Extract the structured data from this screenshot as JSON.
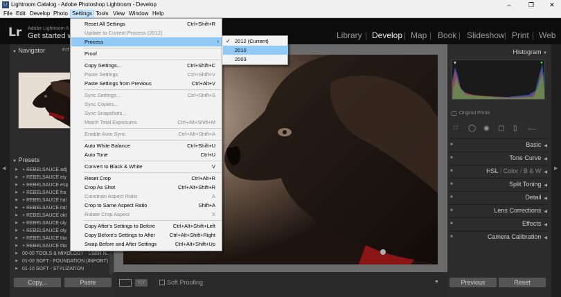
{
  "window": {
    "title": "Lightroom Catalog - Adobe Photoshop Lightroom - Develop",
    "app_icon": "Lr",
    "controls": [
      "–",
      "❐",
      "✕"
    ]
  },
  "menubar": [
    "File",
    "Edit",
    "Develop",
    "Photo",
    "Settings",
    "Tools",
    "View",
    "Window",
    "Help"
  ],
  "identity": {
    "logo": "Lr",
    "version": "Adobe Lightroom 6",
    "headline": "Get started w"
  },
  "modules": [
    "Library",
    "Develop",
    "Map",
    "Book",
    "Slideshow",
    "Print",
    "Web"
  ],
  "active_module": "Develop",
  "left_panel": {
    "navigator_label": "Navigator",
    "navigator_fit": "FIT",
    "presets_label": "Presets",
    "presets": [
      "+ REBELSAUCE adj",
      "+ REBELSAUCE eiy",
      "+ REBELSAUCE esp",
      "+ REBELSAUCE fra",
      "+ REBELSAUCE ital",
      "+ REBELSAUCE ital",
      "+ REBELSAUCE okt",
      "+ REBELSAUCE oly",
      "+ REBELSAUCE oly",
      "+ REBELSAUCE tita",
      "+ REBELSAUCE tita",
      "00-00 TOOLS & MIXOLOGY - USER N...",
      "01-00 SOFT - FOUNDATION (IMPORT)",
      "01-10 SOFT - STYLIZATION"
    ],
    "copy_label": "Copy...",
    "paste_label": "Paste"
  },
  "toolbar": {
    "yy_label": "Y|Y",
    "soft_proofing_label": "Soft Proofing"
  },
  "right_panel": {
    "histogram_label": "Histogram",
    "original_photo_label": "Original Photo",
    "sections": [
      "Basic",
      "Tone Curve",
      "HSL / Color / B & W",
      "Split Toning",
      "Detail",
      "Lens Corrections",
      "Effects",
      "Camera Calibration"
    ],
    "hsl_parts": [
      "HSL",
      "/",
      "Color",
      "/",
      "B & W"
    ],
    "previous_label": "Previous",
    "reset_label": "Reset"
  },
  "settings_menu": {
    "items": [
      {
        "label": "Reset All Settings",
        "shortcut": "Ctrl+Shift+R",
        "disabled": false
      },
      {
        "label": "Update to Current Process (2012)",
        "shortcut": "",
        "disabled": true
      },
      {
        "label": "Process",
        "shortcut": "",
        "disabled": false,
        "submenu": true,
        "highlighted": true
      },
      {
        "label": "Proof",
        "shortcut": "",
        "disabled": false
      },
      {
        "label": "Copy Settings...",
        "shortcut": "Ctrl+Shift+C",
        "disabled": false
      },
      {
        "label": "Paste Settings",
        "shortcut": "Ctrl+Shift+V",
        "disabled": true
      },
      {
        "label": "Paste Settings from Previous",
        "shortcut": "Ctrl+Alt+V",
        "disabled": false
      },
      {
        "label": "Sync Settings...",
        "shortcut": "Ctrl+Shift+S",
        "disabled": true
      },
      {
        "label": "Sync Copies...",
        "shortcut": "",
        "disabled": true
      },
      {
        "label": "Sync Snapshots...",
        "shortcut": "",
        "disabled": true
      },
      {
        "label": "Match Total Exposures",
        "shortcut": "Ctrl+Alt+Shift+M",
        "disabled": true
      },
      {
        "label": "Enable Auto Sync",
        "shortcut": "Ctrl+Alt+Shift+A",
        "disabled": true
      },
      {
        "label": "Auto White Balance",
        "shortcut": "Ctrl+Shift+U",
        "disabled": false
      },
      {
        "label": "Auto Tone",
        "shortcut": "Ctrl+U",
        "disabled": false
      },
      {
        "label": "Convert to Black & White",
        "shortcut": "V",
        "disabled": false
      },
      {
        "label": "Reset Crop",
        "shortcut": "Ctrl+Alt+R",
        "disabled": false
      },
      {
        "label": "Crop As Shot",
        "shortcut": "Ctrl+Alt+Shift+R",
        "disabled": false
      },
      {
        "label": "Constrain Aspect Ratio",
        "shortcut": "A",
        "disabled": true
      },
      {
        "label": "Crop to Same Aspect Ratio",
        "shortcut": "Shift+A",
        "disabled": false
      },
      {
        "label": "Rotate Crop Aspect",
        "shortcut": "X",
        "disabled": true
      },
      {
        "label": "Copy After's Settings to Before",
        "shortcut": "Ctrl+Alt+Shift+Left",
        "disabled": false
      },
      {
        "label": "Copy Before's Settings to After",
        "shortcut": "Ctrl+Alt+Shift+Right",
        "disabled": false
      },
      {
        "label": "Swap Before and After Settings",
        "shortcut": "Ctrl+Alt+Shift+Up",
        "disabled": false
      }
    ]
  },
  "process_submenu": {
    "items": [
      {
        "label": "2012 (Current)",
        "checked": true,
        "highlighted": false
      },
      {
        "label": "2010",
        "checked": false,
        "highlighted": true
      },
      {
        "label": "2003",
        "checked": false,
        "highlighted": false
      }
    ]
  },
  "colors": {
    "menu_highlight": "#91c9f7",
    "panel_bg": "#2c2c2c",
    "identity_bg": "#0d0d0d"
  }
}
